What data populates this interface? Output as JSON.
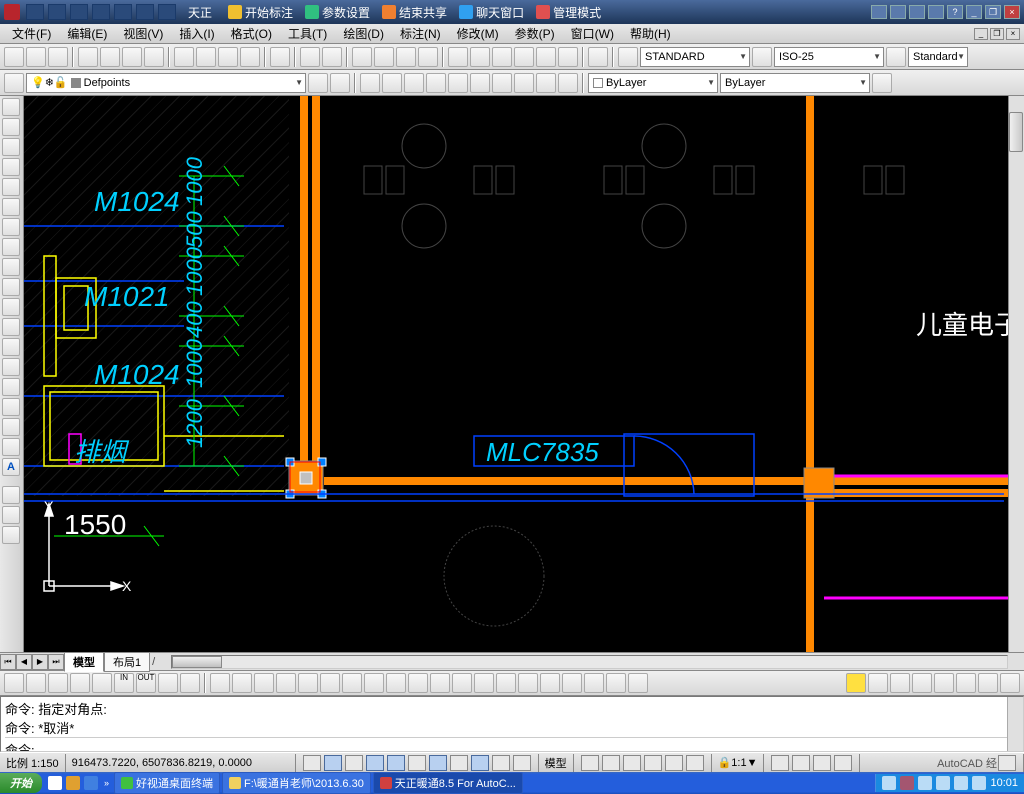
{
  "title_partial": "天正",
  "collab_tabs": [
    {
      "label": "开始标注",
      "color": "#f0c030"
    },
    {
      "label": "参数设置",
      "color": "#30c080"
    },
    {
      "label": "结束共享",
      "color": "#f08030"
    },
    {
      "label": "聊天窗口",
      "color": "#30a0f0"
    },
    {
      "label": "管理模式",
      "color": "#e05050"
    }
  ],
  "menus": [
    "文件(F)",
    "编辑(E)",
    "视图(V)",
    "插入(I)",
    "格式(O)",
    "工具(T)",
    "绘图(D)",
    "标注(N)",
    "修改(M)",
    "参数(P)",
    "窗口(W)",
    "帮助(H)"
  ],
  "text_style": "STANDARD",
  "dim_style": "ISO-25",
  "table_style": "Standard",
  "layer_name": "Defpoints",
  "linetype": "ByLayer",
  "lineweight": "ByLayer",
  "canvas": {
    "door_label_1": "M1024",
    "door_label_2": "M1021",
    "door_label_3": "M1024",
    "label_paiyan": "排烟",
    "window_label": "MLC7835",
    "room_label": "儿童电子阅",
    "dim_1550": "1550",
    "dim_1200": "1200",
    "dim_1000_a": "1000",
    "dim_1000_b": "1000",
    "dim_1000_c": "1000",
    "dim_500": "500",
    "dim_400": "400",
    "ucs_x": "X",
    "ucs_y": "Y"
  },
  "sheet_tabs": {
    "model": "模型",
    "layout1": "布局1"
  },
  "cmd_history": [
    "命令: 指定对角点:",
    "命令: *取消*"
  ],
  "cmd_prompt": "命令:",
  "status": {
    "scale_label": "比例 1:150",
    "coords": "916473.7220, 6507836.8219, 0.0000",
    "model_btn": "模型",
    "anno_scale": "1:1",
    "tray_label": "AutoCAD 经"
  },
  "taskbar": {
    "start": "开始",
    "items": [
      "好视通桌面终端",
      "F:\\暖通肖老师\\2013.6.30",
      "天正暖通8.5 For AutoC..."
    ],
    "clock": "10:01"
  }
}
